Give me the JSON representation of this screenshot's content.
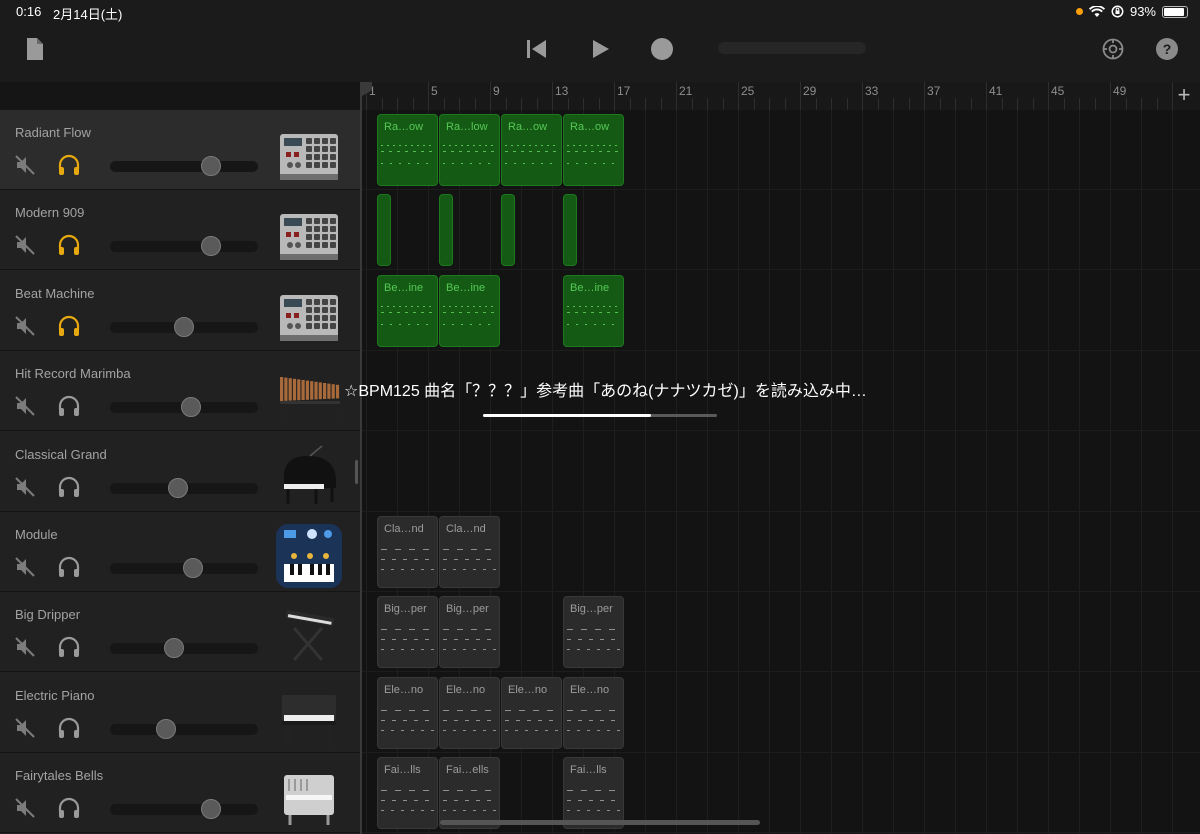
{
  "status_bar": {
    "time": "0:16",
    "date": "2月14日(土)",
    "battery": "93%"
  },
  "ruler": {
    "bars": [
      "1",
      "5",
      "9",
      "13",
      "17",
      "21",
      "25",
      "29",
      "33",
      "37",
      "41",
      "45",
      "49"
    ]
  },
  "loading": {
    "message": "☆BPM125 曲名「？？？」参考曲「あのね(ナナツカゼ)」を読み込み中…",
    "progress": 0.72
  },
  "tracks": [
    {
      "name": "Radiant Flow",
      "headphones_active": true,
      "volume": 0.68,
      "instrument": "drum-machine",
      "selected": true
    },
    {
      "name": "Modern 909",
      "headphones_active": true,
      "volume": 0.68,
      "instrument": "drum-machine"
    },
    {
      "name": "Beat Machine",
      "headphones_active": true,
      "volume": 0.5,
      "instrument": "drum-machine"
    },
    {
      "name": "Hit Record Marimba",
      "headphones_active": false,
      "volume": 0.55,
      "instrument": "marimba"
    },
    {
      "name": "Classical Grand",
      "headphones_active": false,
      "volume": 0.46,
      "instrument": "grand-piano"
    },
    {
      "name": "Module",
      "headphones_active": false,
      "volume": 0.56,
      "instrument": "synth-module"
    },
    {
      "name": "Big Dripper",
      "headphones_active": false,
      "volume": 0.43,
      "instrument": "keyboard-stand"
    },
    {
      "name": "Electric Piano",
      "headphones_active": false,
      "volume": 0.38,
      "instrument": "electric-piano"
    },
    {
      "name": "Fairytales Bells",
      "headphones_active": false,
      "volume": 0.68,
      "instrument": "celesta"
    }
  ],
  "lanes": [
    {
      "color": "green",
      "regions": [
        {
          "label": "Ra…ow",
          "bar": 1
        },
        {
          "label": "Ra…low",
          "bar": 5
        },
        {
          "label": "Ra…ow",
          "bar": 9
        },
        {
          "label": "Ra…ow",
          "bar": 13
        }
      ]
    },
    {
      "color": "green",
      "regions": [
        {
          "label": "",
          "bar": 1,
          "slim": true
        },
        {
          "label": "",
          "bar": 5,
          "slim": true
        },
        {
          "label": "",
          "bar": 9,
          "slim": true
        },
        {
          "label": "",
          "bar": 13,
          "slim": true
        }
      ]
    },
    {
      "color": "green",
      "regions": [
        {
          "label": "Be…ine",
          "bar": 1
        },
        {
          "label": "Be…ine",
          "bar": 5
        },
        {
          "label": "Be…ine",
          "bar": 13
        }
      ]
    },
    {
      "color": "gray",
      "regions": []
    },
    {
      "color": "gray",
      "regions": []
    },
    {
      "color": "gray",
      "regions": [
        {
          "label": "Cla…nd",
          "bar": 1
        },
        {
          "label": "Cla…nd",
          "bar": 5
        }
      ]
    },
    {
      "color": "gray",
      "regions": [
        {
          "label": "Big…per",
          "bar": 1
        },
        {
          "label": "Big…per",
          "bar": 5
        },
        {
          "label": "Big…per",
          "bar": 13
        }
      ]
    },
    {
      "color": "gray",
      "regions": [
        {
          "label": "Ele…no",
          "bar": 1
        },
        {
          "label": "Ele…no",
          "bar": 5
        },
        {
          "label": "Ele…no",
          "bar": 9
        },
        {
          "label": "Ele…no",
          "bar": 13
        }
      ]
    },
    {
      "color": "gray",
      "regions": [
        {
          "label": "Fai…lls",
          "bar": 1
        },
        {
          "label": "Fai…ells",
          "bar": 5
        },
        {
          "label": "Fai…lls",
          "bar": 13
        }
      ]
    }
  ],
  "colors": {
    "accent_headphone": "#e7a90f",
    "region_green": "#145a14",
    "region_gray": "#2b2b2b"
  }
}
